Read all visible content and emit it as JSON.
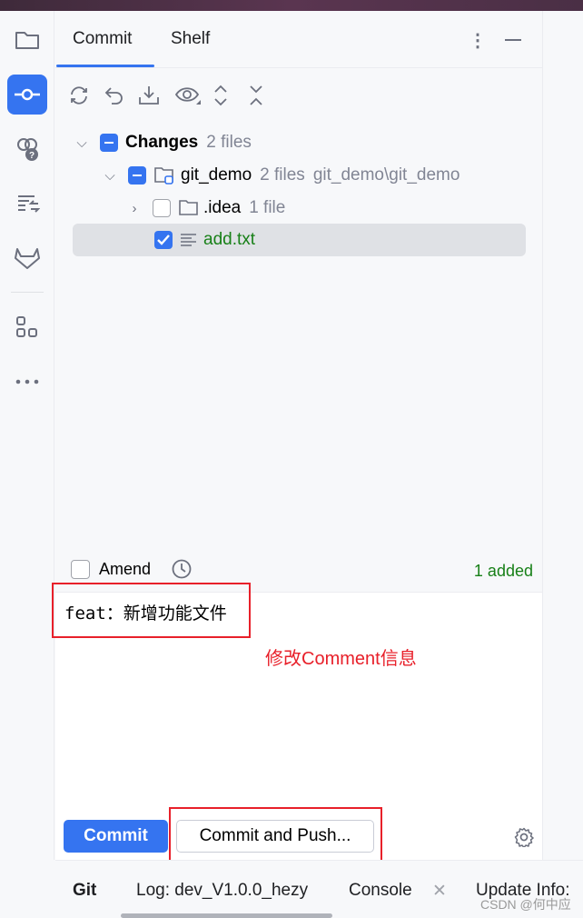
{
  "sidebar": {
    "items": [
      "folder-icon",
      "commit-icon",
      "pull-requests-icon",
      "structure-icon",
      "gitlab-icon",
      "plugins-icon",
      "more-icon"
    ]
  },
  "tabs": {
    "commit": "Commit",
    "shelf": "Shelf"
  },
  "toolbar": [
    "refresh-icon",
    "rollback-icon",
    "update-icon",
    "view-options-icon",
    "expand-all-icon",
    "collapse-all-icon"
  ],
  "tree": {
    "changes": {
      "label": "Changes",
      "count": "2 files"
    },
    "git_demo": {
      "label": "git_demo",
      "count": "2 files",
      "path": "git_demo\\git_demo"
    },
    "idea": {
      "label": ".idea",
      "count": "1 file"
    },
    "file": {
      "label": "add.txt"
    }
  },
  "amend": {
    "label": "Amend",
    "status": "1 added"
  },
  "message": {
    "text": "feat：新增功能文件",
    "annotation": "修改Comment信息"
  },
  "buttons": {
    "commit": "Commit",
    "commit_push": "Commit and Push..."
  },
  "bottom": {
    "tabs": [
      "Git",
      "Log: dev_V1.0.0_hezy",
      "Console",
      "Update Info:"
    ]
  },
  "watermark": "CSDN @何中应",
  "colors": {
    "accent": "#3574f0",
    "added": "#188018",
    "annotation": "#e8202a"
  }
}
